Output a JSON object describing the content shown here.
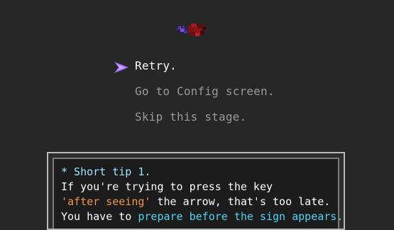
{
  "menu": {
    "items": [
      {
        "label": "Retry.",
        "selected": true
      },
      {
        "label": "Go to Config screen.",
        "selected": false
      },
      {
        "label": "Skip this stage.",
        "selected": false
      }
    ]
  },
  "tip": {
    "title": "* Short tip 1.",
    "line1": "If you're trying to press the key",
    "line2_highlight": "'after seeing'",
    "line2_rest": " the arrow, that's too late.",
    "line3_prefix": "You have to ",
    "line3_highlight": "prepare before the sign appears."
  },
  "colors": {
    "background": "#272727",
    "cursor": "#a36bff",
    "title": "#9fe3ff",
    "highlight_orange": "#f0964c",
    "highlight_cyan": "#4fd3f0"
  }
}
